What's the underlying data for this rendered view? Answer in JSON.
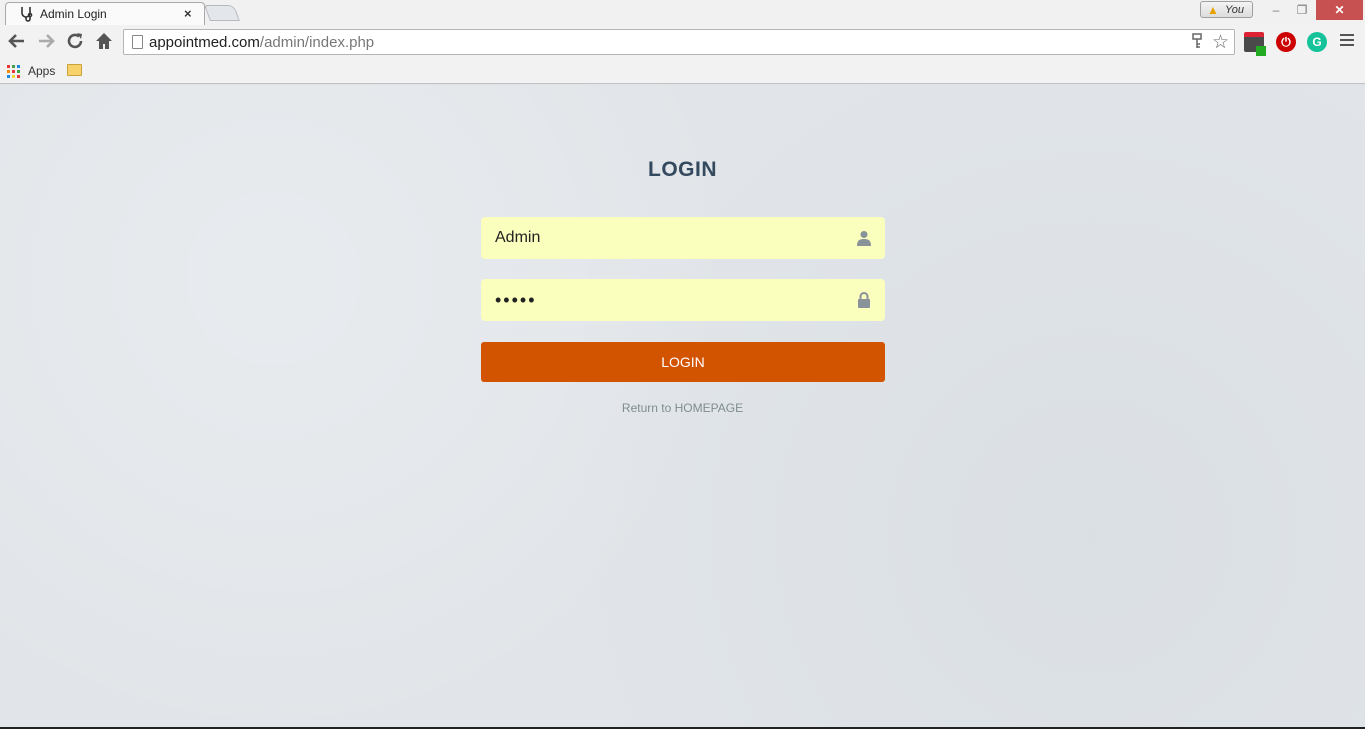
{
  "tab": {
    "title": "Admin Login",
    "close": "×"
  },
  "profile": {
    "name": "You"
  },
  "window": {
    "minimize": "–",
    "maximize": "❐",
    "close": "✕"
  },
  "toolbar": {
    "url_host": "appointmed.com",
    "url_path": "/admin/index.php",
    "ext_two": "⏻",
    "ext_three": "G"
  },
  "bookmarks": {
    "apps_label": "Apps"
  },
  "login": {
    "title": "LOGIN",
    "username_value": "Admin",
    "password_value": "•••••",
    "button_label": "LOGIN",
    "return_label": "Return to HOMEPAGE"
  },
  "colors": {
    "accent": "#d35400",
    "autofill": "#faffbd",
    "title": "#34495e",
    "background": "#e1e5e9"
  }
}
